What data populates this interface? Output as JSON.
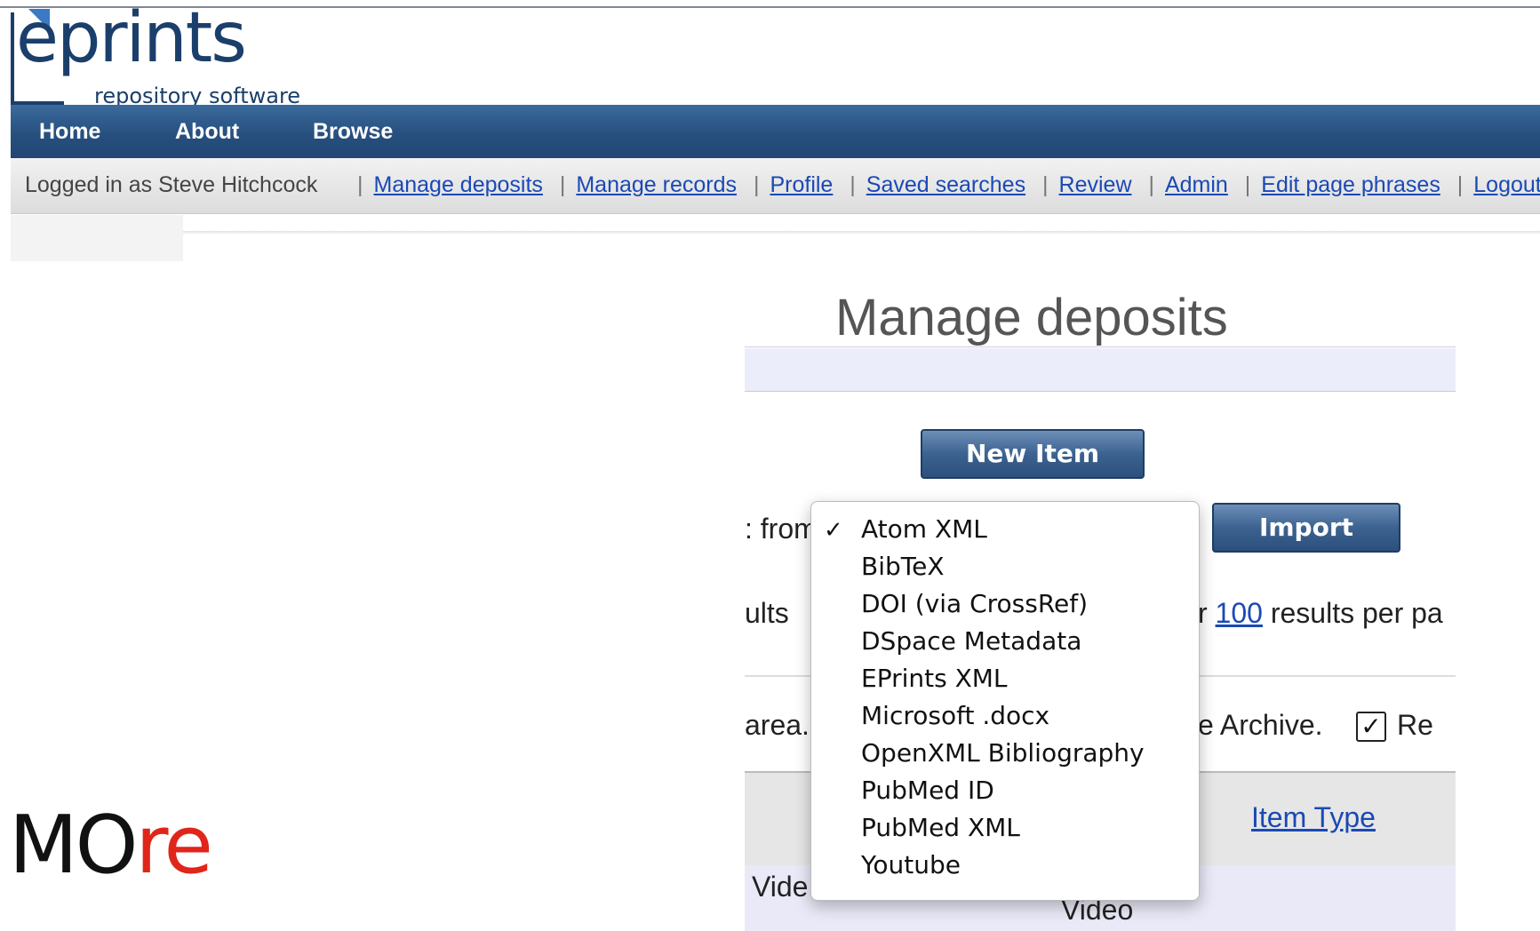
{
  "logo": {
    "main": "eprints",
    "tagline": "repository software"
  },
  "nav": {
    "items": [
      "Home",
      "About",
      "Browse"
    ]
  },
  "userbar": {
    "logged_in": "Logged in as Steve Hitchcock",
    "links": [
      "Manage deposits",
      "Manage records",
      "Profile",
      "Saved searches",
      "Review",
      "Admin",
      "Edit page phrases",
      "Logout"
    ]
  },
  "page": {
    "title": "Manage deposits",
    "new_item_label": "New Item",
    "import_label": "Import",
    "import_from_fragment": ": from",
    "results_fragment": "ults",
    "per_page_or": "r",
    "per_page_value": "100",
    "per_page_suffix": "results per pa",
    "area_fragment": "area.",
    "live_archive_fragment": "e Archive.",
    "review_fragment": "Re",
    "item_type_header": "Item Type",
    "row_title_fragment": "Vide",
    "row_type": "Video"
  },
  "import_menu": {
    "selected": "Atom XML",
    "options": [
      "Atom XML",
      "BibTeX",
      "DOI (via CrossRef)",
      "DSpace Metadata",
      "EPrints XML",
      "Microsoft .docx",
      "OpenXML Bibliography",
      "PubMed ID",
      "PubMed XML",
      "Youtube"
    ]
  },
  "watermark": {
    "dark": "MO",
    "red": "re"
  },
  "colors": {
    "nav": "#27507f",
    "link": "#1a49b5",
    "more_red": "#e0251b"
  }
}
